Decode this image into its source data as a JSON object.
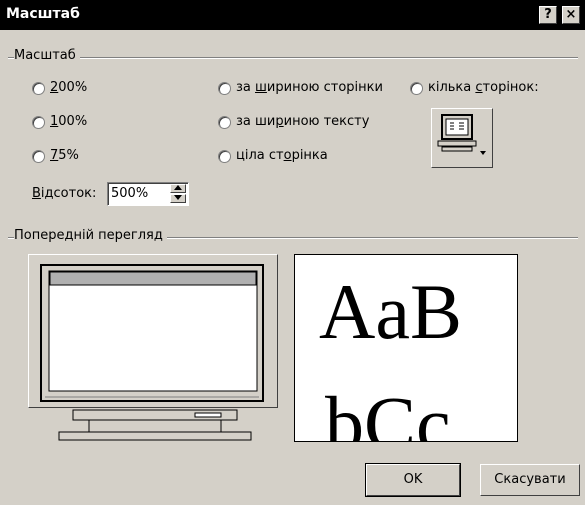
{
  "window": {
    "title": "Масштаб",
    "help_label": "?",
    "close_label": "×"
  },
  "zoom_group": {
    "label": "Масштаб",
    "options": [
      {
        "pre": "",
        "acc": "2",
        "post": "00%"
      },
      {
        "pre": "",
        "acc": "1",
        "post": "00%"
      },
      {
        "pre": "",
        "acc": "7",
        "post": "5%"
      },
      {
        "pre": "за ",
        "acc": "ш",
        "post": "ириною сторінки"
      },
      {
        "pre": "за ши",
        "acc": "р",
        "post": "иною тексту"
      },
      {
        "pre": "ціла ст",
        "acc": "о",
        "post": "рінка"
      },
      {
        "pre": "кілька ",
        "acc": "с",
        "post": "торінок:"
      }
    ],
    "percent": {
      "label_acc": "В",
      "label_post": "ідсоток:",
      "value": "500%",
      "up_icon": "triangle-up",
      "down_icon": "triangle-down"
    },
    "multi_pages_icon": "multiple-pages-monitor-icon"
  },
  "preview_group": {
    "label": "Попередній перегляд",
    "sample_line1": "AaB",
    "sample_line2": "bCc"
  },
  "buttons": {
    "ok": "OK",
    "cancel": "Скасувати"
  }
}
